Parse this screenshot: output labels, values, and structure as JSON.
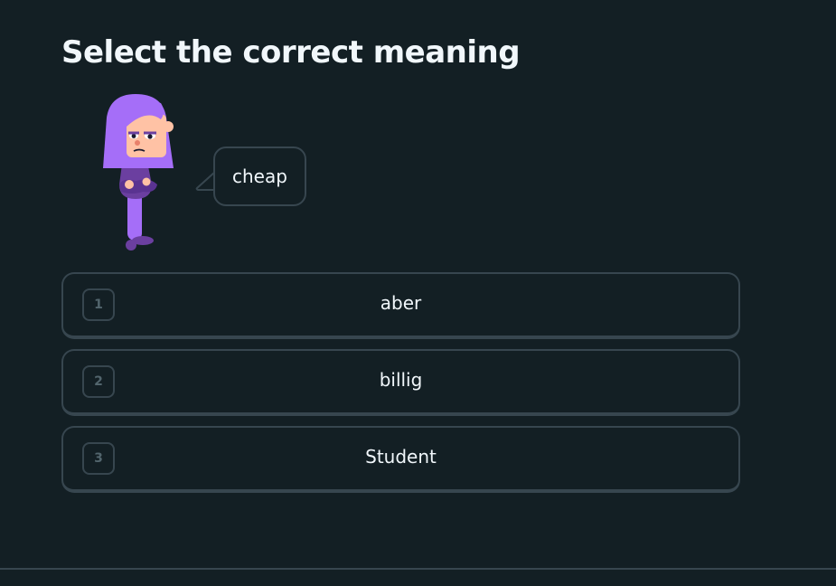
{
  "challenge": {
    "title": "Select the correct meaning"
  },
  "speech_bubble": {
    "text": "cheap"
  },
  "character": {
    "icon": "lily-character"
  },
  "choices": [
    {
      "number": "1",
      "label": "aber"
    },
    {
      "number": "2",
      "label": "billig"
    },
    {
      "number": "3",
      "label": "Student"
    }
  ],
  "colors": {
    "background": "#131f24",
    "border": "#37464f",
    "text": "#f1f7fb",
    "muted": "#52656d",
    "character_hair": "#a56ef8",
    "character_skin": "#ffc2a5",
    "character_body": "#6b3fa0"
  }
}
